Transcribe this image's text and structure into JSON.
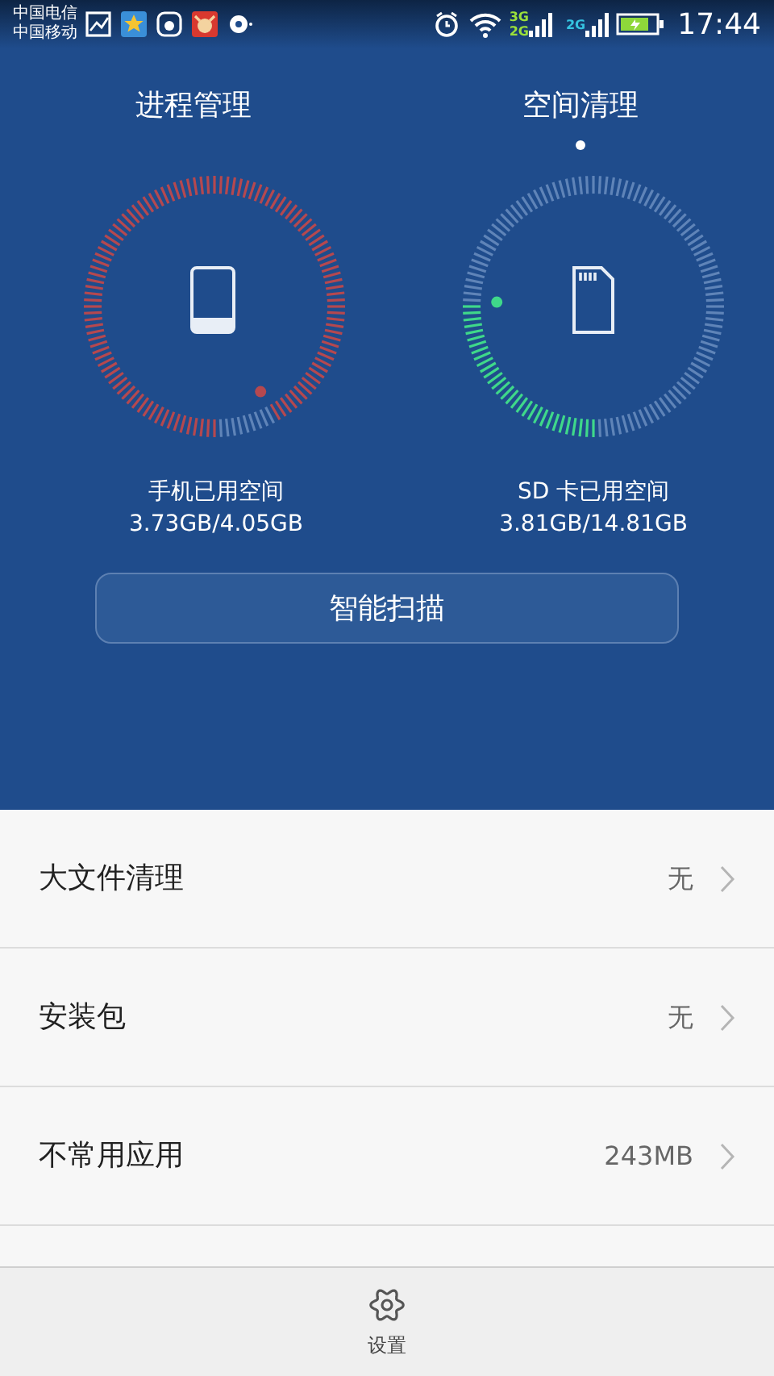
{
  "status_bar": {
    "carriers": [
      "中国电信",
      "中国移动"
    ],
    "network_labels": [
      "3G",
      "2G",
      "2G"
    ],
    "time": "17:44"
  },
  "tabs": [
    {
      "label": "进程管理",
      "selected": false
    },
    {
      "label": "空间清理",
      "selected": true
    }
  ],
  "gauges": [
    {
      "kind": "phone",
      "color": "#b5484f",
      "label": "手机已用空间",
      "reading": "3.73GB/4.05GB"
    },
    {
      "kind": "sd",
      "color": "#3fd88a",
      "label": "SD 卡已用空间",
      "reading": "3.81GB/14.81GB"
    }
  ],
  "scan_button": "智能扫描",
  "list": [
    {
      "title": "大文件清理",
      "value": "无"
    },
    {
      "title": "安装包",
      "value": "无"
    },
    {
      "title": "不常用应用",
      "value": "243MB"
    }
  ],
  "bottom_bar": {
    "label": "设置"
  }
}
